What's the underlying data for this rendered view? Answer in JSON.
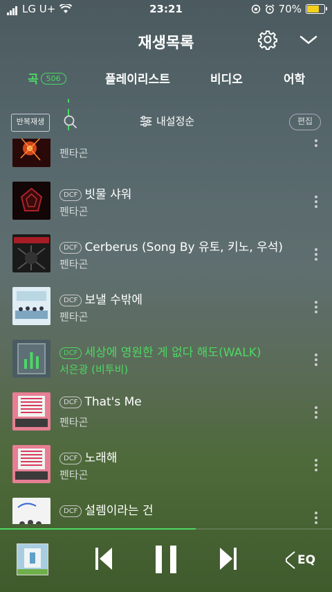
{
  "status": {
    "carrier": "LG U+",
    "time": "23:21",
    "battery": "70%",
    "battery_level": 0.7
  },
  "header": {
    "title": "재생목록"
  },
  "tabs": [
    {
      "label": "곡",
      "badge": "506",
      "active": true
    },
    {
      "label": "플레이리스트"
    },
    {
      "label": "비디오"
    },
    {
      "label": "어학"
    }
  ],
  "toolbar": {
    "repeat_label": "반복재생",
    "sort_label": "내설정순",
    "edit_label": "편집"
  },
  "songs": [
    {
      "title": "",
      "artist": "펜타곤",
      "dcf": ""
    },
    {
      "title": "빗물 샤워",
      "artist": "펜타곤",
      "dcf": "DCF"
    },
    {
      "title": "Cerberus (Song By 유토, 키노, 우석)",
      "artist": "펜타곤",
      "dcf": "DCF"
    },
    {
      "title": "보낼 수밖에",
      "artist": "펜타곤",
      "dcf": "DCF"
    },
    {
      "title": "세상에 영원한 게 없다 해도(WALK)",
      "artist": "서은광 (비투비)",
      "dcf": "DCF",
      "playing": true
    },
    {
      "title": "That's Me",
      "artist": "펜타곤",
      "dcf": "DCF"
    },
    {
      "title": "노래해",
      "artist": "펜타곤",
      "dcf": "DCF"
    },
    {
      "title": "설렘이라는 건",
      "artist": "",
      "dcf": "DCF"
    }
  ],
  "player": {
    "progress": 0.59,
    "eq_label": "EQ"
  },
  "colors": {
    "accent": "#4cd964"
  }
}
